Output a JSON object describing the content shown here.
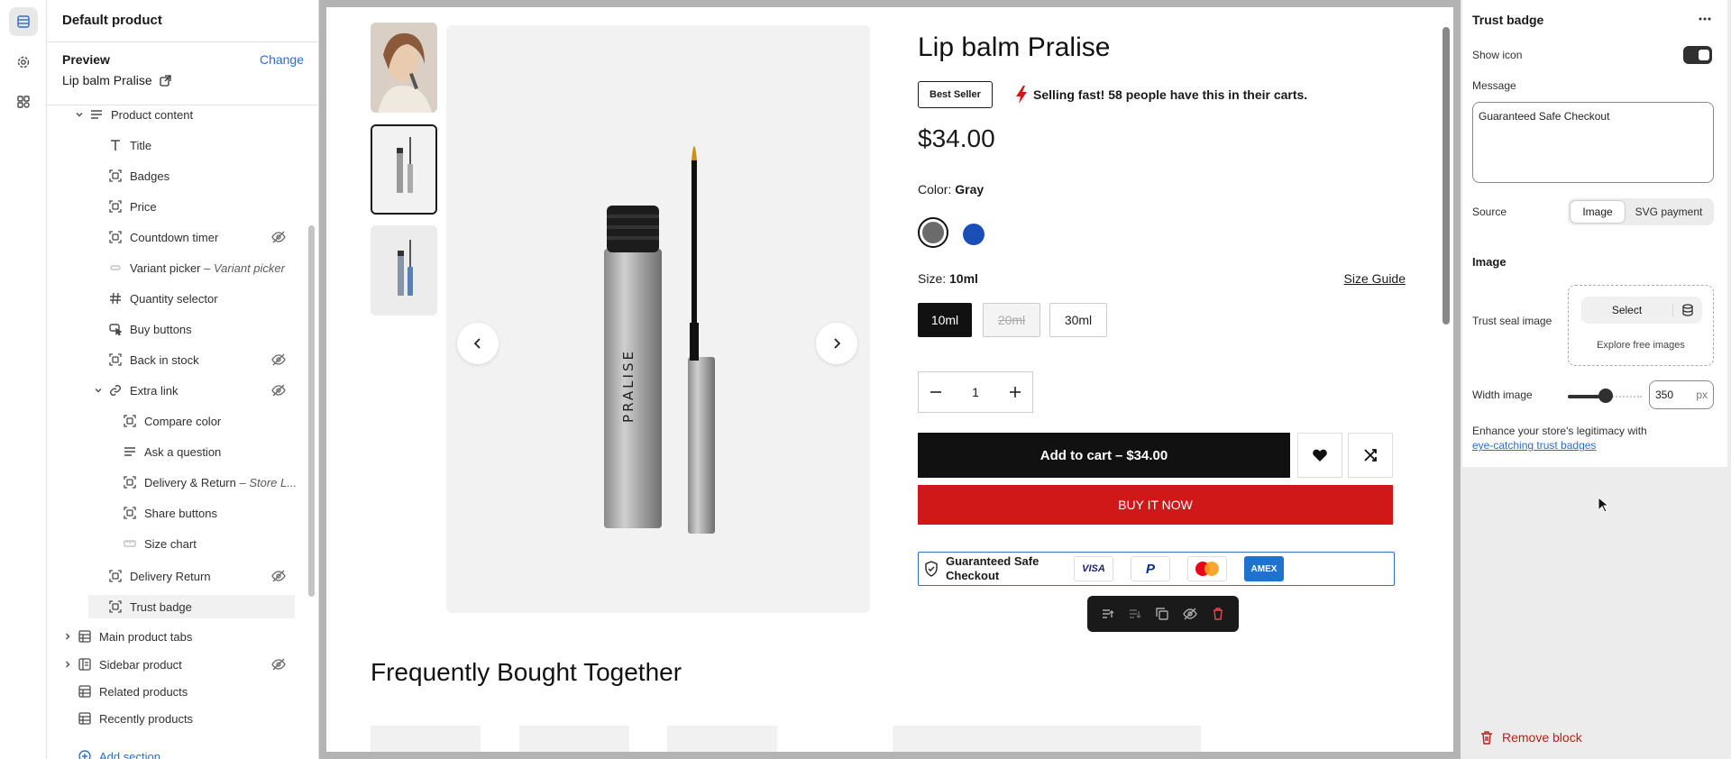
{
  "sidebar_left": {
    "header": "Default product",
    "preview_label": "Preview",
    "change_label": "Change",
    "preview_value": "Lip balm Pralise",
    "tree": [
      {
        "label": "Product content",
        "icon": "lines-icon",
        "level": 0,
        "expanded": true
      },
      {
        "label": "Title",
        "icon": "text-icon",
        "level": 1
      },
      {
        "label": "Badges",
        "icon": "block-icon",
        "level": 1
      },
      {
        "label": "Price",
        "icon": "block-icon",
        "level": 1
      },
      {
        "label": "Countdown timer",
        "icon": "block-icon",
        "level": 1,
        "hidden": true
      },
      {
        "label": "Variant picker",
        "suffix": "Variant picker",
        "icon": "variant-icon",
        "level": 1
      },
      {
        "label": "Quantity selector",
        "icon": "hash-icon",
        "level": 1
      },
      {
        "label": "Buy buttons",
        "icon": "buy-icon",
        "level": 1
      },
      {
        "label": "Back in stock",
        "icon": "block-icon",
        "level": 1,
        "hidden": true
      },
      {
        "label": "Extra link",
        "icon": "link-icon",
        "level": 1,
        "expanded": true,
        "hidden": true
      },
      {
        "label": "Compare color",
        "icon": "block-icon",
        "level": 2
      },
      {
        "label": "Ask a question",
        "icon": "lines-icon",
        "level": 2
      },
      {
        "label": "Delivery & Return",
        "suffix": "Store L...",
        "icon": "block-icon",
        "level": 2
      },
      {
        "label": "Share buttons",
        "icon": "block-icon",
        "level": 2
      },
      {
        "label": "Size chart",
        "icon": "sizechart-icon",
        "level": 2
      },
      {
        "label": "Delivery Return",
        "icon": "block-icon",
        "level": 1,
        "hidden": true
      },
      {
        "label": "Trust badge",
        "icon": "block-icon",
        "level": 1,
        "selected": true
      },
      {
        "label": "Main product tabs",
        "icon": "table-icon",
        "level": 0,
        "collapsed": true
      },
      {
        "label": "Sidebar product",
        "icon": "sidebar-icon",
        "level": 0,
        "collapsed": true,
        "hidden": true
      },
      {
        "label": "Related products",
        "icon": "table-icon",
        "level": 0
      },
      {
        "label": "Recently products",
        "icon": "table-icon",
        "level": 0
      }
    ],
    "add_section": "Add section"
  },
  "product": {
    "title": "Lip balm Pralise",
    "badge": "Best Seller",
    "selling": "Selling fast! 58 people have this in their carts.",
    "price": "$34.00",
    "color_label": "Color:",
    "color_value": "Gray",
    "swatches": [
      "#6b6b6b",
      "#1a4fb8"
    ],
    "size_label": "Size:",
    "size_value": "10ml",
    "size_guide": "Size Guide",
    "sizes": [
      "10ml",
      "20ml",
      "30ml"
    ],
    "quantity": "1",
    "add_to_cart": "Add to cart",
    "add_to_cart_price": "$34.00",
    "buy_now": "BUY IT NOW",
    "brand_on_tube": "PRALISE"
  },
  "trust_badge": {
    "message": "Guaranteed Safe Checkout",
    "payments": [
      "VISA",
      "P",
      "mastercard",
      "AMEX"
    ]
  },
  "section_title": "Frequently Bought Together",
  "settings": {
    "title": "Trust badge",
    "show_icon_label": "Show icon",
    "show_icon": true,
    "message_label": "Message",
    "message_value": "Guaranteed Safe Checkout",
    "source_label": "Source",
    "source_options": [
      "Image",
      "SVG payment"
    ],
    "source_selected": "Image",
    "image_heading": "Image",
    "trust_seal_label": "Trust seal image",
    "select_label": "Select",
    "explore_label": "Explore free images",
    "width_label": "Width image",
    "width_value": "350",
    "width_unit": "px",
    "enhance_text": "Enhance your store's legitimacy with",
    "enhance_link": "eye-catching trust badges",
    "remove_label": "Remove block"
  },
  "colors": {
    "accent": "#2c6ecb",
    "buy_now": "#d01818",
    "remove": "#b42318"
  }
}
